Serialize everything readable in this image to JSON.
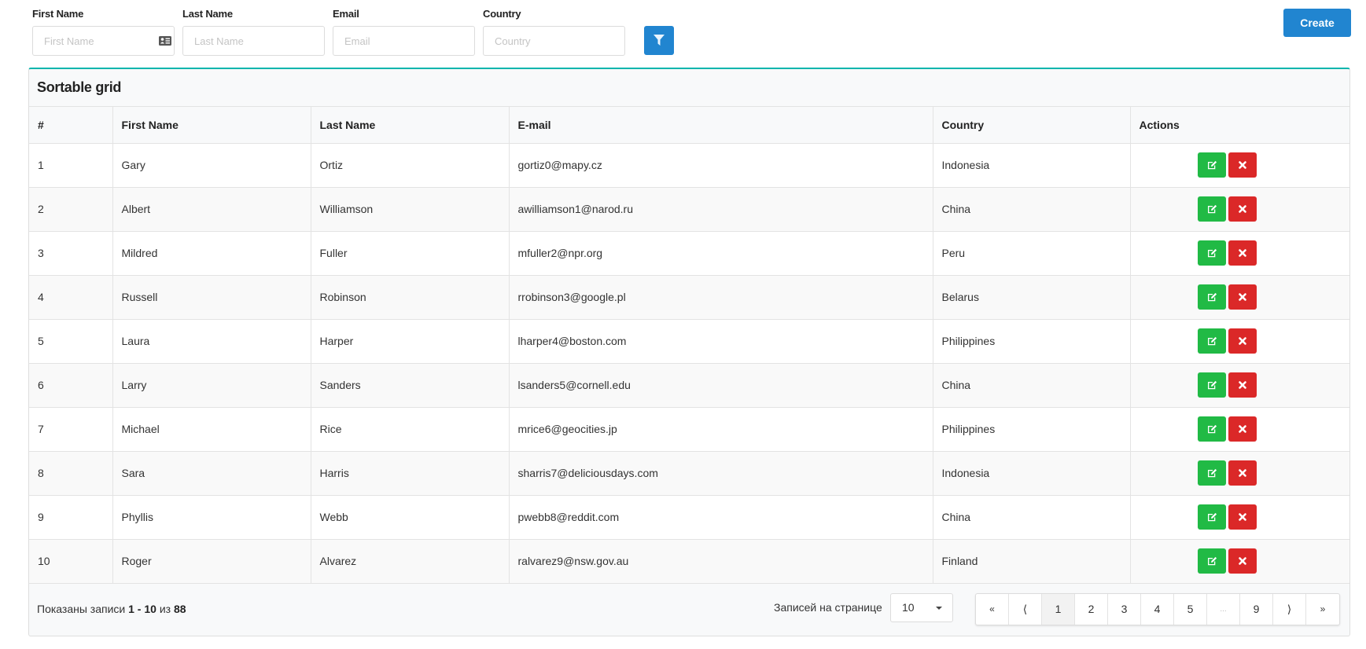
{
  "filters": {
    "first_name": {
      "label": "First Name",
      "placeholder": "First Name",
      "value": ""
    },
    "last_name": {
      "label": "Last Name",
      "placeholder": "Last Name",
      "value": ""
    },
    "email": {
      "label": "Email",
      "placeholder": "Email",
      "value": ""
    },
    "country": {
      "label": "Country",
      "placeholder": "Country",
      "value": ""
    },
    "filter_icon": "filter-icon"
  },
  "toolbar": {
    "create_label": "Create"
  },
  "grid": {
    "title": "Sortable grid",
    "columns": [
      "#",
      "First Name",
      "Last Name",
      "E-mail",
      "Country",
      "Actions"
    ],
    "rows": [
      {
        "num": "1",
        "first": "Gary",
        "last": "Ortiz",
        "email": "gortiz0@mapy.cz",
        "country": "Indonesia"
      },
      {
        "num": "2",
        "first": "Albert",
        "last": "Williamson",
        "email": "awilliamson1@narod.ru",
        "country": "China"
      },
      {
        "num": "3",
        "first": "Mildred",
        "last": "Fuller",
        "email": "mfuller2@npr.org",
        "country": "Peru"
      },
      {
        "num": "4",
        "first": "Russell",
        "last": "Robinson",
        "email": "rrobinson3@google.pl",
        "country": "Belarus"
      },
      {
        "num": "5",
        "first": "Laura",
        "last": "Harper",
        "email": "lharper4@boston.com",
        "country": "Philippines"
      },
      {
        "num": "6",
        "first": "Larry",
        "last": "Sanders",
        "email": "lsanders5@cornell.edu",
        "country": "China"
      },
      {
        "num": "7",
        "first": "Michael",
        "last": "Rice",
        "email": "mrice6@geocities.jp",
        "country": "Philippines"
      },
      {
        "num": "8",
        "first": "Sara",
        "last": "Harris",
        "email": "sharris7@deliciousdays.com",
        "country": "Indonesia"
      },
      {
        "num": "9",
        "first": "Phyllis",
        "last": "Webb",
        "email": "pwebb8@reddit.com",
        "country": "China"
      },
      {
        "num": "10",
        "first": "Roger",
        "last": "Alvarez",
        "email": "ralvarez9@nsw.gov.au",
        "country": "Finland"
      }
    ],
    "row_actions": {
      "edit_icon": "edit-icon",
      "delete_icon": "close-icon"
    }
  },
  "footer": {
    "shown_prefix": "Показаны записи",
    "shown_range": "1 - 10",
    "shown_of": "из",
    "shown_total": "88",
    "per_page_label": "Записей на странице",
    "per_page_value": "10",
    "pagination": {
      "first": "«",
      "prev": "⟨",
      "pages": [
        "1",
        "2",
        "3",
        "4",
        "5"
      ],
      "ellipsis": "...",
      "last_page": "9",
      "next": "⟩",
      "last": "»",
      "current": "1"
    }
  },
  "colors": {
    "primary": "#2185d0",
    "accent_border": "#00b5ad",
    "edit": "#21ba45",
    "delete": "#db2828"
  }
}
